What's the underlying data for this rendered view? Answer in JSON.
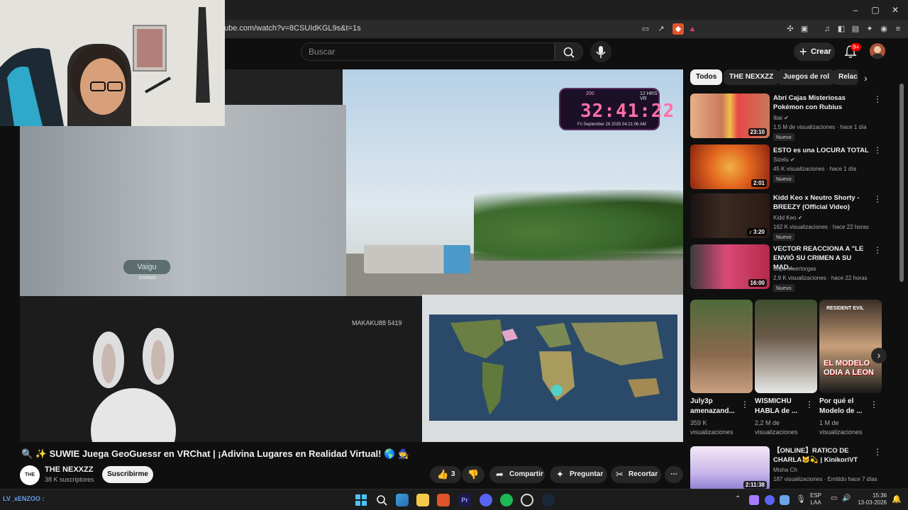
{
  "browser": {
    "url": "ube.com/watch?v=8CSUIdKGL9s&t=1s",
    "window_controls": {
      "minimize": "–",
      "maximize": "▢",
      "close": "✕"
    }
  },
  "youtube_header": {
    "search_placeholder": "Buscar",
    "create_label": "Crear",
    "notifications_badge": "9+"
  },
  "video": {
    "timer": "32:41:22",
    "timer_top_left": "200",
    "timer_top_right": "12 HRS VR",
    "timer_date": "Fri September 26 2025 04:21:06 AM",
    "player_tag_1": "Vaigu",
    "player_tag_1_sub": "Invitado",
    "player_tag_2": "MAKAKU88 5419",
    "title": "🔍 ✨ SUWIE Juega GeoGuessr en VRChat | ¡Adivina Lugares en Realidad Virtual! 🌎 🧙",
    "channel_name": "THE NEXXZZ",
    "channel_avatar_text": "THE NEX",
    "channel_subs": "38 K suscriptores",
    "subscribe_label": "Suscribirme",
    "likes": "3",
    "share_label": "Compartir",
    "ask_label": "Preguntar",
    "clip_label": "Recortar",
    "more_label": "⋯"
  },
  "sidebar": {
    "chips": [
      "Todos",
      "THE NEXXZZ",
      "Juegos de rol",
      "Relac"
    ],
    "recommendations": [
      {
        "title": "Abrí Cajas Misteriosas Pokémon con Rubius",
        "channel": "Ibai",
        "verified": true,
        "stats": "1,5 M de visualizaciones · hace 1 día",
        "badge": "Nuevo",
        "duration": "23:10"
      },
      {
        "title": "ESTO es una LOCURA TOTAL",
        "channel": "Sizelu",
        "verified": true,
        "stats": "45 K visualizaciones · hace 1 día",
        "badge": "Nuevo",
        "duration": "2:01"
      },
      {
        "title": "Kidd Keo x Neutro Shorty - BREEZY (Official Video)",
        "channel": "Kidd Keo",
        "verified": true,
        "stats": "162 K visualizaciones · hace 22 horas",
        "badge": "Nuevo",
        "duration": "♪ 3:20"
      },
      {
        "title": "VECTOR REACCIONA A \"LE ENVIÓ SU CRIMEN A SU MAD...",
        "channel": "Clips Muertorgas",
        "verified": false,
        "stats": "2,9 K visualizaciones · hace 22 horas",
        "badge": "Nuevo",
        "duration": "16:00"
      }
    ],
    "shorts": [
      {
        "title": "July3p amenazand...",
        "views": "359 K visualizaciones"
      },
      {
        "title": "WISMICHU HABLA de ...",
        "views": "2,2 M de visualizaciones"
      },
      {
        "title": "Por qué el Modelo de ...",
        "views": "1 M de visualizaciones",
        "overlay_top": "RESIDENT EVIL",
        "overlay_text": "EL MODELO ODIA A LEON"
      }
    ],
    "last_rec": {
      "title": "【ONLINE】RATICO DE CHARLA🐱💫 | KinikoriVT",
      "channel": "Misha Ch",
      "stats": "187 visualizaciones · Emitido hace 7 días",
      "duration": "2:11:38"
    }
  },
  "taskbar": {
    "left_text": "LV_xENZOO : ",
    "lang_top": "ESP",
    "lang_bottom": "LAA",
    "time": "15:36",
    "date": "13-03-2026"
  },
  "colors": {
    "background": "#0f0f0f",
    "timer_pink": "#ff6fa6",
    "notif_red": "#e00000",
    "subscribe_bg": "#f1f1f1"
  }
}
